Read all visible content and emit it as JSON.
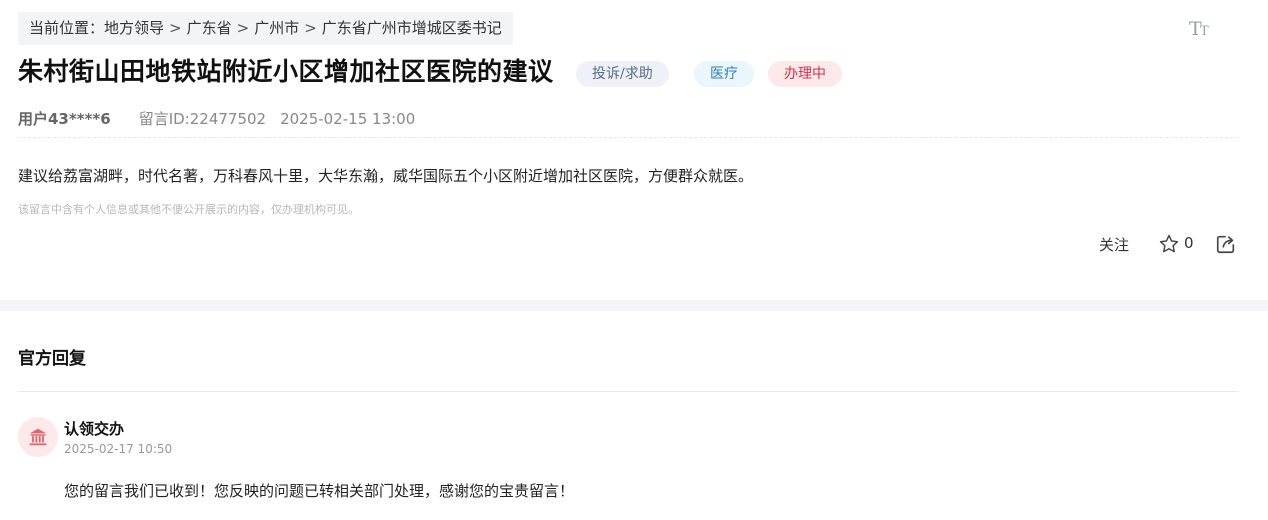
{
  "breadcrumb": {
    "prefix": "当前位置：",
    "items": [
      "地方领导",
      "广东省",
      "广州市",
      "广东省广州市增城区委书记"
    ],
    "separator": ">"
  },
  "post": {
    "title": "朱村街山田地铁站附近小区增加社区医院的建议",
    "tags": {
      "type": "投诉/求助",
      "category": "医疗",
      "status": "办理中"
    },
    "user": "用户43****6",
    "message_id": "留言ID:22477502",
    "datetime": "2025-02-15 13:00",
    "content": "建议给荔富湖畔，时代名著，万科春风十里，大华东瀚，威华国际五个小区附近增加社区医院，方便群众就医。",
    "privacy_note": "该留言中含有个人信息或其他不便公开展示的内容，仅办理机构可见。"
  },
  "actions": {
    "follow_label": "关注",
    "star_count": "0"
  },
  "reply": {
    "section_title": "官方回复",
    "org": "认领交办",
    "time": "2025-02-17 10:50",
    "body": "您的留言我们已收到！您反映的问题已转相关部门处理，感谢您的宝贵留言！"
  },
  "icons": {
    "font_size": "font-size-icon",
    "star": "star-icon",
    "share": "share-icon",
    "government": "government-building-icon"
  },
  "colors": {
    "status_red": "#d1344b",
    "category_blue": "#2f7fb3",
    "type_gray": "#5b6b86"
  }
}
